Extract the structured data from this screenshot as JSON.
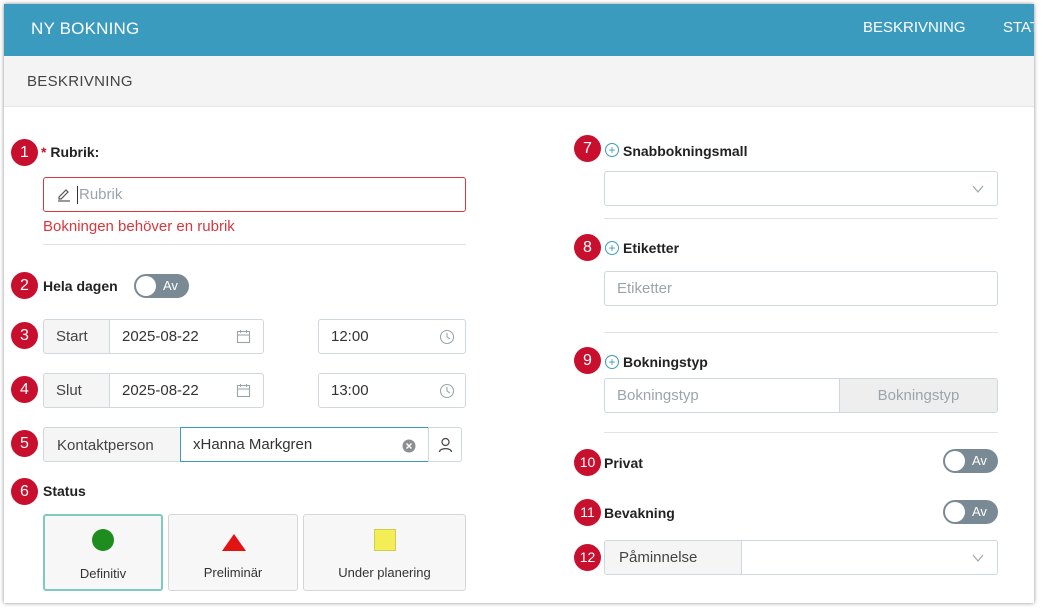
{
  "header": {
    "title": "NY BOKNING",
    "nav": [
      "BESKRIVNING",
      "STATUS"
    ]
  },
  "section": {
    "title": "BESKRIVNING"
  },
  "badges": [
    "1",
    "2",
    "3",
    "4",
    "5",
    "6",
    "7",
    "8",
    "9",
    "10",
    "11",
    "12"
  ],
  "rubrik": {
    "required_mark": "*",
    "label": "Rubrik:",
    "placeholder": "Rubrik",
    "error": "Bokningen behöver en rubrik"
  },
  "hela_dagen": {
    "label": "Hela dagen",
    "toggle": "Av"
  },
  "start": {
    "label": "Start",
    "date": "2025-08-22",
    "time": "12:00"
  },
  "slut": {
    "label": "Slut",
    "date": "2025-08-22",
    "time": "13:00"
  },
  "kontakt": {
    "label": "Kontaktperson",
    "value": "xHanna Markgren"
  },
  "status": {
    "label": "Status",
    "options": [
      {
        "label": "Definitiv",
        "color": "#1e8c1e",
        "shape": "circle",
        "selected": true
      },
      {
        "label": "Preliminär",
        "color": "#e21313",
        "shape": "triangle",
        "selected": false
      },
      {
        "label": "Under planering",
        "color": "#f3ee55",
        "shape": "square",
        "selected": false
      }
    ]
  },
  "snabbmall": {
    "label": "Snabbokningsmall",
    "value": ""
  },
  "etiketter": {
    "label": "Etiketter",
    "placeholder": "Etiketter"
  },
  "bokningstyp": {
    "label": "Bokningstyp",
    "placeholder": "Bokningstyp",
    "button": "Bokningstyp"
  },
  "privat": {
    "label": "Privat",
    "toggle": "Av"
  },
  "bevakning": {
    "label": "Bevakning",
    "toggle": "Av"
  },
  "paminnelse": {
    "label": "Påminnelse",
    "value": ""
  },
  "colors": {
    "header": "#3b9bbf",
    "badge": "#c8102e",
    "error": "#d9363e"
  }
}
